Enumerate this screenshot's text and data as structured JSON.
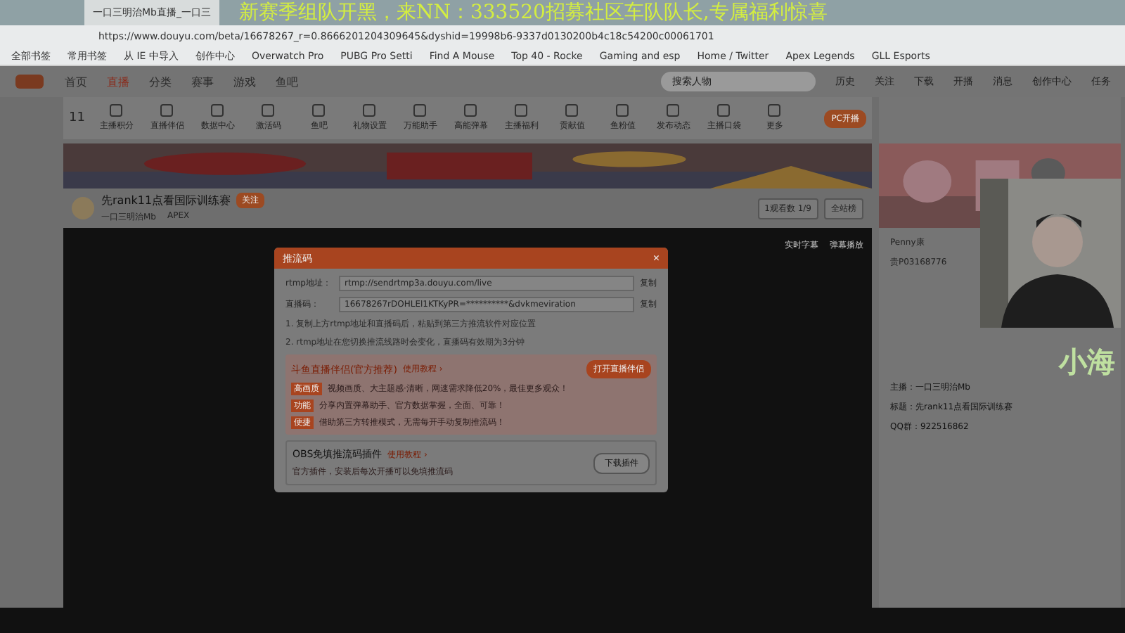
{
  "overlay_text": "新赛季组队开黑，来NN：333520招募社区车队队长,专属福利惊喜",
  "browser": {
    "tab": "一口三明治Mb直播_一口三",
    "address": "https://www.douyu.com/beta/16678267_r=0.8666201204309645&dyshid=19998b6-9337d0130200b4c18c54200c00061701",
    "bookmarks": [
      "全部书签",
      "常用书签",
      "从 IE 中导入",
      "创作中心",
      "Overwatch Pro",
      "PUBG Pro Setti",
      "Find A Mouse",
      "Top 40 - Rocke",
      "Gaming and esp",
      "Home / Twitter",
      "Apex Legends",
      "GLL Esports"
    ]
  },
  "site": {
    "nav": [
      {
        "label": "首页",
        "selected": false
      },
      {
        "label": "直播",
        "selected": true
      },
      {
        "label": "分类",
        "selected": false
      },
      {
        "label": "赛事",
        "selected": false
      },
      {
        "label": "游戏",
        "selected": false
      },
      {
        "label": "鱼吧",
        "selected": false
      }
    ],
    "search": {
      "placeholder": "搜索人物"
    },
    "header_icons": [
      "历史",
      "关注",
      "下载",
      "开播",
      "消息",
      "创作中心",
      "任务"
    ]
  },
  "tools": [
    "主播积分",
    "直播伴侣",
    "数据中心",
    "激活码",
    "鱼吧",
    "礼物设置",
    "万能助手",
    "高能弹幕",
    "主播福利",
    "贡献值",
    "鱼粉值",
    "发布动态",
    "主播口袋",
    "更多"
  ],
  "score": "11",
  "record_button": "PC开播",
  "room": {
    "title": "先rank11点看国际训练赛",
    "follow": "关注",
    "category": "APEX",
    "streamer": "一口三明治Mb"
  },
  "room_buttons": [
    "1观看数 1/9",
    "全站榜"
  ],
  "video_controls": [
    "实时字幕",
    "弹幕播放"
  ],
  "dialog": {
    "title": "推流码",
    "close": "×",
    "fields": [
      {
        "label": "rtmp地址：",
        "value": "rtmp://sendrtmp3a.douyu.com/live",
        "copy": "复制"
      },
      {
        "label": "直播码：",
        "value": "16678267rDOHLEl1KTKyPR=**********&dvkmeviration",
        "copy": "复制"
      }
    ],
    "notes": [
      "1. 复制上方rtmp地址和直播码后，粘贴到第三方推流软件对应位置",
      "2. rtmp地址在您切换推流线路时会变化，直播码有效期为3分钟"
    ],
    "companion": {
      "name": "斗鱼直播伴侣(官方推荐)",
      "tutorial": "使用教程 ›",
      "button": "打开直播伴侣",
      "features": [
        {
          "tag": "高画质",
          "text": "视频画质、大主题感·清晰，网速需求降低20%，最佳更多观众！"
        },
        {
          "tag": "功能",
          "text": "分享内置弹幕助手、官方数据掌握，全面、可靠！"
        },
        {
          "tag": "便捷",
          "text": "借助第三方转推模式，无需每开手动复制推流码！"
        }
      ]
    },
    "obs": {
      "name": "OBS免填推流码插件",
      "tutorial": "使用教程 ›",
      "text": "官方插件，安装后每次开播可以免填推流码",
      "button": "下载插件"
    }
  },
  "chat": {
    "users": [
      "Penny康",
      "贵P03168776"
    ],
    "info": [
      "主播：一口三明治Mb",
      "标题：先rank11点看国际训练赛",
      "QQ群：922516862"
    ]
  },
  "cam_caption": "小海"
}
